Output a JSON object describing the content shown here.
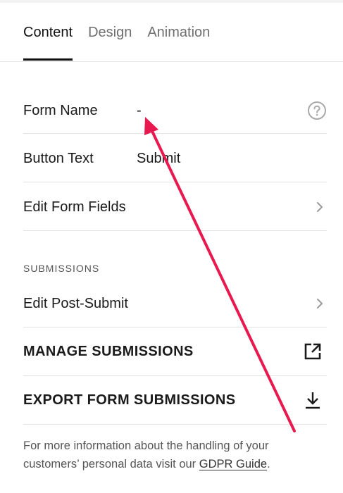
{
  "tabs": [
    {
      "label": "Content",
      "active": true
    },
    {
      "label": "Design",
      "active": false
    },
    {
      "label": "Animation",
      "active": false
    }
  ],
  "rows": {
    "form_name": {
      "label": "Form Name",
      "value": "-"
    },
    "button_text": {
      "label": "Button Text",
      "value": "Submit"
    },
    "edit_form_fields": {
      "label": "Edit Form Fields"
    }
  },
  "section": {
    "label": "SUBMISSIONS"
  },
  "submissions": {
    "edit_post_submit": "Edit Post-Submit",
    "manage": "MANAGE SUBMISSIONS",
    "export": "EXPORT FORM SUBMISSIONS"
  },
  "footer": {
    "text": "For more information about the handling of your customers’ personal data visit our",
    "link": "GDPR Guide",
    "end": "."
  },
  "colors": {
    "annotation_arrow": "#e8194f",
    "text": "#1a1a1a",
    "muted": "#6f6f6f"
  },
  "icons": [
    "help-icon",
    "chevron-right-icon",
    "external-link-icon",
    "download-icon"
  ]
}
